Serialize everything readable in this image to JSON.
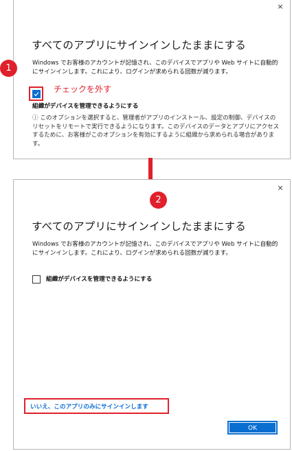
{
  "dialog_before": {
    "close_glyph": "×",
    "title": "すべてのアプリにサインインしたままにする",
    "description": "Windows でお客様のアカウントが記憶され、このデバイスでアプリや Web サイトに自動的にサインインします。これにより、ログインが求められる回数が減ります。",
    "checkbox_label": "組織がデバイスを管理できるようにする",
    "checkbox_checked": true,
    "info_text": "ⓘ このオプションを選択すると、管理者がアプリのインストール、設定の制御、デバイスのリセットをリモートで実行できるようになります。このデバイスのデータとアプリにアクセスするために、お客様がこのオプションを有効にするように組織から求められる場合があります。"
  },
  "dialog_after": {
    "close_glyph": "×",
    "title": "すべてのアプリにサインインしたままにする",
    "description": "Windows でお客様のアカウントが記憶され、このデバイスでアプリや Web サイトに自動的にサインインします。これにより、ログインが求められる回数が減ります。",
    "checkbox_label": "組織がデバイスを管理できるようにする",
    "checkbox_checked": false,
    "link_text": "いいえ、このアプリのみにサインインします",
    "ok_label": "OK"
  },
  "annotations": {
    "step1_number": "1",
    "step1_note": "チェックを外す",
    "step2_number": "2",
    "highlight_color": "#e0202c"
  },
  "colors": {
    "accent": "#0a6ed1",
    "annotation_red": "#e0202c"
  }
}
